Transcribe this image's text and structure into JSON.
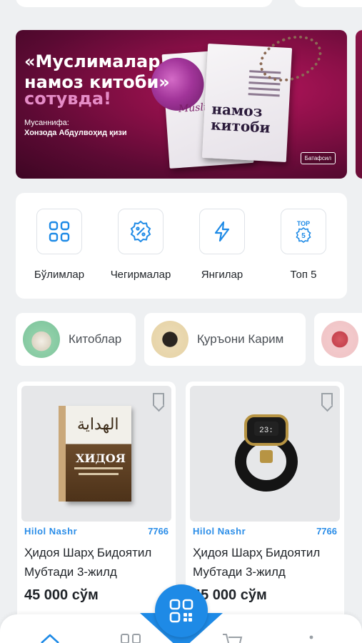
{
  "banner": {
    "title": "«Муслималар намоз китоби»",
    "subtitle": "сотувда!",
    "author_label": "Мусаннифа:",
    "author": "Хонзода Абдулвоҳид қизи",
    "book_title_script": "Muslimalar",
    "book_title": "намоз китоби",
    "details_button": "Батафсил"
  },
  "quick_actions": [
    {
      "label": "Бўлимлар",
      "icon": "grid-icon"
    },
    {
      "label": "Чегирмалар",
      "icon": "discount-badge-icon"
    },
    {
      "label": "Янгилар",
      "icon": "lightning-icon"
    },
    {
      "label": "Топ 5",
      "icon": "top5-badge-icon",
      "badge": "TOP"
    }
  ],
  "categories": [
    {
      "label": "Китоблар"
    },
    {
      "label": "Қуръони Карим"
    }
  ],
  "products": [
    {
      "publisher": "Hilol Nashr",
      "code": "7766",
      "name": "Ҳидоя Шарҳ Бидоятил Мубтади 3-жилд",
      "price": "45 000 сўм",
      "cover_arabic": "الهداية",
      "cover_title": "ХИДОЯ"
    },
    {
      "publisher": "Hilol Nashr",
      "code": "7766",
      "name": "Ҳидоя Шарҳ Бидоятил Мубтади 3-жилд",
      "price": "45 000 сўм"
    }
  ],
  "nav": {
    "fab_icon": "qr-code-icon",
    "tabs": [
      "home-icon",
      "catalog-icon",
      "cart-icon",
      "more-icon"
    ]
  },
  "colors": {
    "accent": "#1e8ae6",
    "banner": "#8a0f47",
    "subtitle_pink": "#e58cc7"
  }
}
